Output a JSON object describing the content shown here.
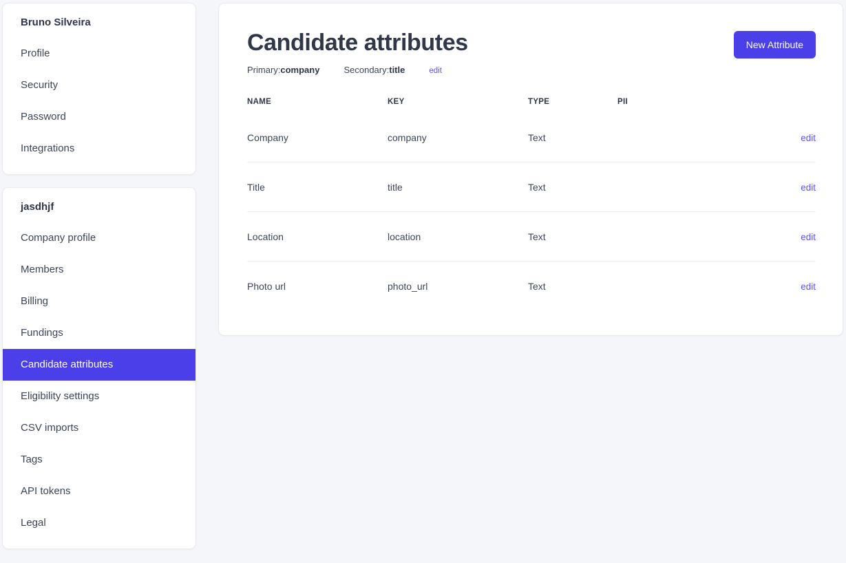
{
  "theme": {
    "accent": "#4a3fe8",
    "link": "#5b55ee",
    "text": "#3c4557",
    "heading": "#2f3748",
    "page_bg": "#f5f6f9",
    "card_bg": "#ffffff",
    "border": "#e8eaef"
  },
  "sidebar": {
    "cards": [
      {
        "title": "Bruno Silveira",
        "items": [
          {
            "label": "Profile",
            "active": false
          },
          {
            "label": "Security",
            "active": false
          },
          {
            "label": "Password",
            "active": false
          },
          {
            "label": "Integrations",
            "active": false
          }
        ]
      },
      {
        "title": "jasdhjf",
        "items": [
          {
            "label": "Company profile",
            "active": false
          },
          {
            "label": "Members",
            "active": false
          },
          {
            "label": "Billing",
            "active": false
          },
          {
            "label": "Fundings",
            "active": false
          },
          {
            "label": "Candidate attributes",
            "active": true
          },
          {
            "label": "Eligibility settings",
            "active": false
          },
          {
            "label": "CSV imports",
            "active": false
          },
          {
            "label": "Tags",
            "active": false
          },
          {
            "label": "API tokens",
            "active": false
          },
          {
            "label": "Legal",
            "active": false
          }
        ]
      }
    ]
  },
  "main": {
    "title": "Candidate attributes",
    "new_attribute_label": "New Attribute",
    "meta": {
      "primary_label": "Primary:",
      "primary_value": "company",
      "secondary_label": "Secondary:",
      "secondary_value": "title",
      "edit_label": "edit"
    },
    "table": {
      "columns": [
        "NAME",
        "KEY",
        "TYPE",
        "PII"
      ],
      "action_label": "edit",
      "rows": [
        {
          "name": "Company",
          "key": "company",
          "type": "Text",
          "pii": "",
          "action": "edit"
        },
        {
          "name": "Title",
          "key": "title",
          "type": "Text",
          "pii": "",
          "action": "edit"
        },
        {
          "name": "Location",
          "key": "location",
          "type": "Text",
          "pii": "",
          "action": "edit"
        },
        {
          "name": "Photo url",
          "key": "photo_url",
          "type": "Text",
          "pii": "",
          "action": "edit"
        }
      ]
    }
  }
}
